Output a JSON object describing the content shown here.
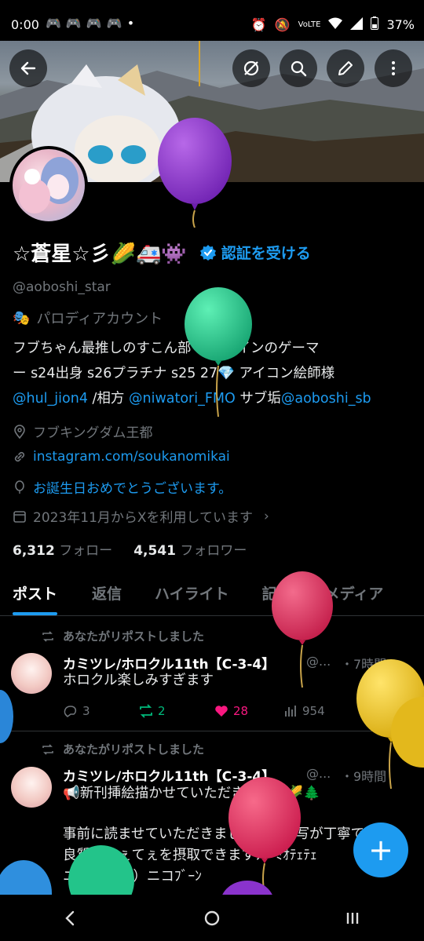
{
  "status_bar": {
    "time": "0:00",
    "battery": "37%",
    "network": "VoLTE"
  },
  "profile": {
    "display_name": "☆蒼星☆彡🌽🚑👾",
    "verify_label": "認証を受ける",
    "handle": "@aoboshi_star",
    "parody_label": "パロディアカウント",
    "bio_line1": "フブちゃん最推しのすこん部 エペメインのゲーマ",
    "bio_line2": "ー s24出身 s26プラチナ s25 27💎  アイコン絵師様",
    "bio_mention1": "@hul_jion4",
    "bio_partner": " /相方 ",
    "bio_mention2": "@niwatori_FMO",
    "bio_sub": " サブ垢",
    "bio_mention3": "@aoboshi_sb",
    "location": "フブキングダム王都",
    "website": "instagram.com/soukanomikai",
    "birthday": "お誕生日おめでとうございます。",
    "joined": "2023年11月からXを利用しています",
    "following_count": "6,312",
    "following_label": "フォロー",
    "followers_count": "4,541",
    "followers_label": "フォロワー"
  },
  "tabs": [
    "ポスト",
    "返信",
    "ハイライト",
    "記事",
    "メディア"
  ],
  "posts": [
    {
      "repost_label": "あなたがリポストしました",
      "author": "カミツレ/ホロクル11th【C-3-4】",
      "handle": "@...",
      "time": "・7時間",
      "text": "ホロクル楽しみすぎます",
      "replies": "3",
      "reposts": "2",
      "likes": "28",
      "views": "954"
    },
    {
      "repost_label": "あなたがリポストしました",
      "author": "カミツレ/ホロクル11th【C-3-4】",
      "handle": "@...",
      "time": "・9時間",
      "text_line1": "📢新刊挿絵描かせていただきました🌽🌲",
      "text_line2": "事前に読ませていただきましたが、描写が丁寧で",
      "text_line3": "良質なてぇてぇを摂取できますﾌﾌﾞﾐｵﾃｪﾃｪ",
      "text_line4": "ニ（ ˆ ω ˆ ）ニコﾌﾞｰﾝ"
    }
  ],
  "fab_label": "+",
  "colors": {
    "accent": "#1d9bf0",
    "like": "#f91880",
    "repost": "#00ba7c",
    "background": "#000000"
  }
}
